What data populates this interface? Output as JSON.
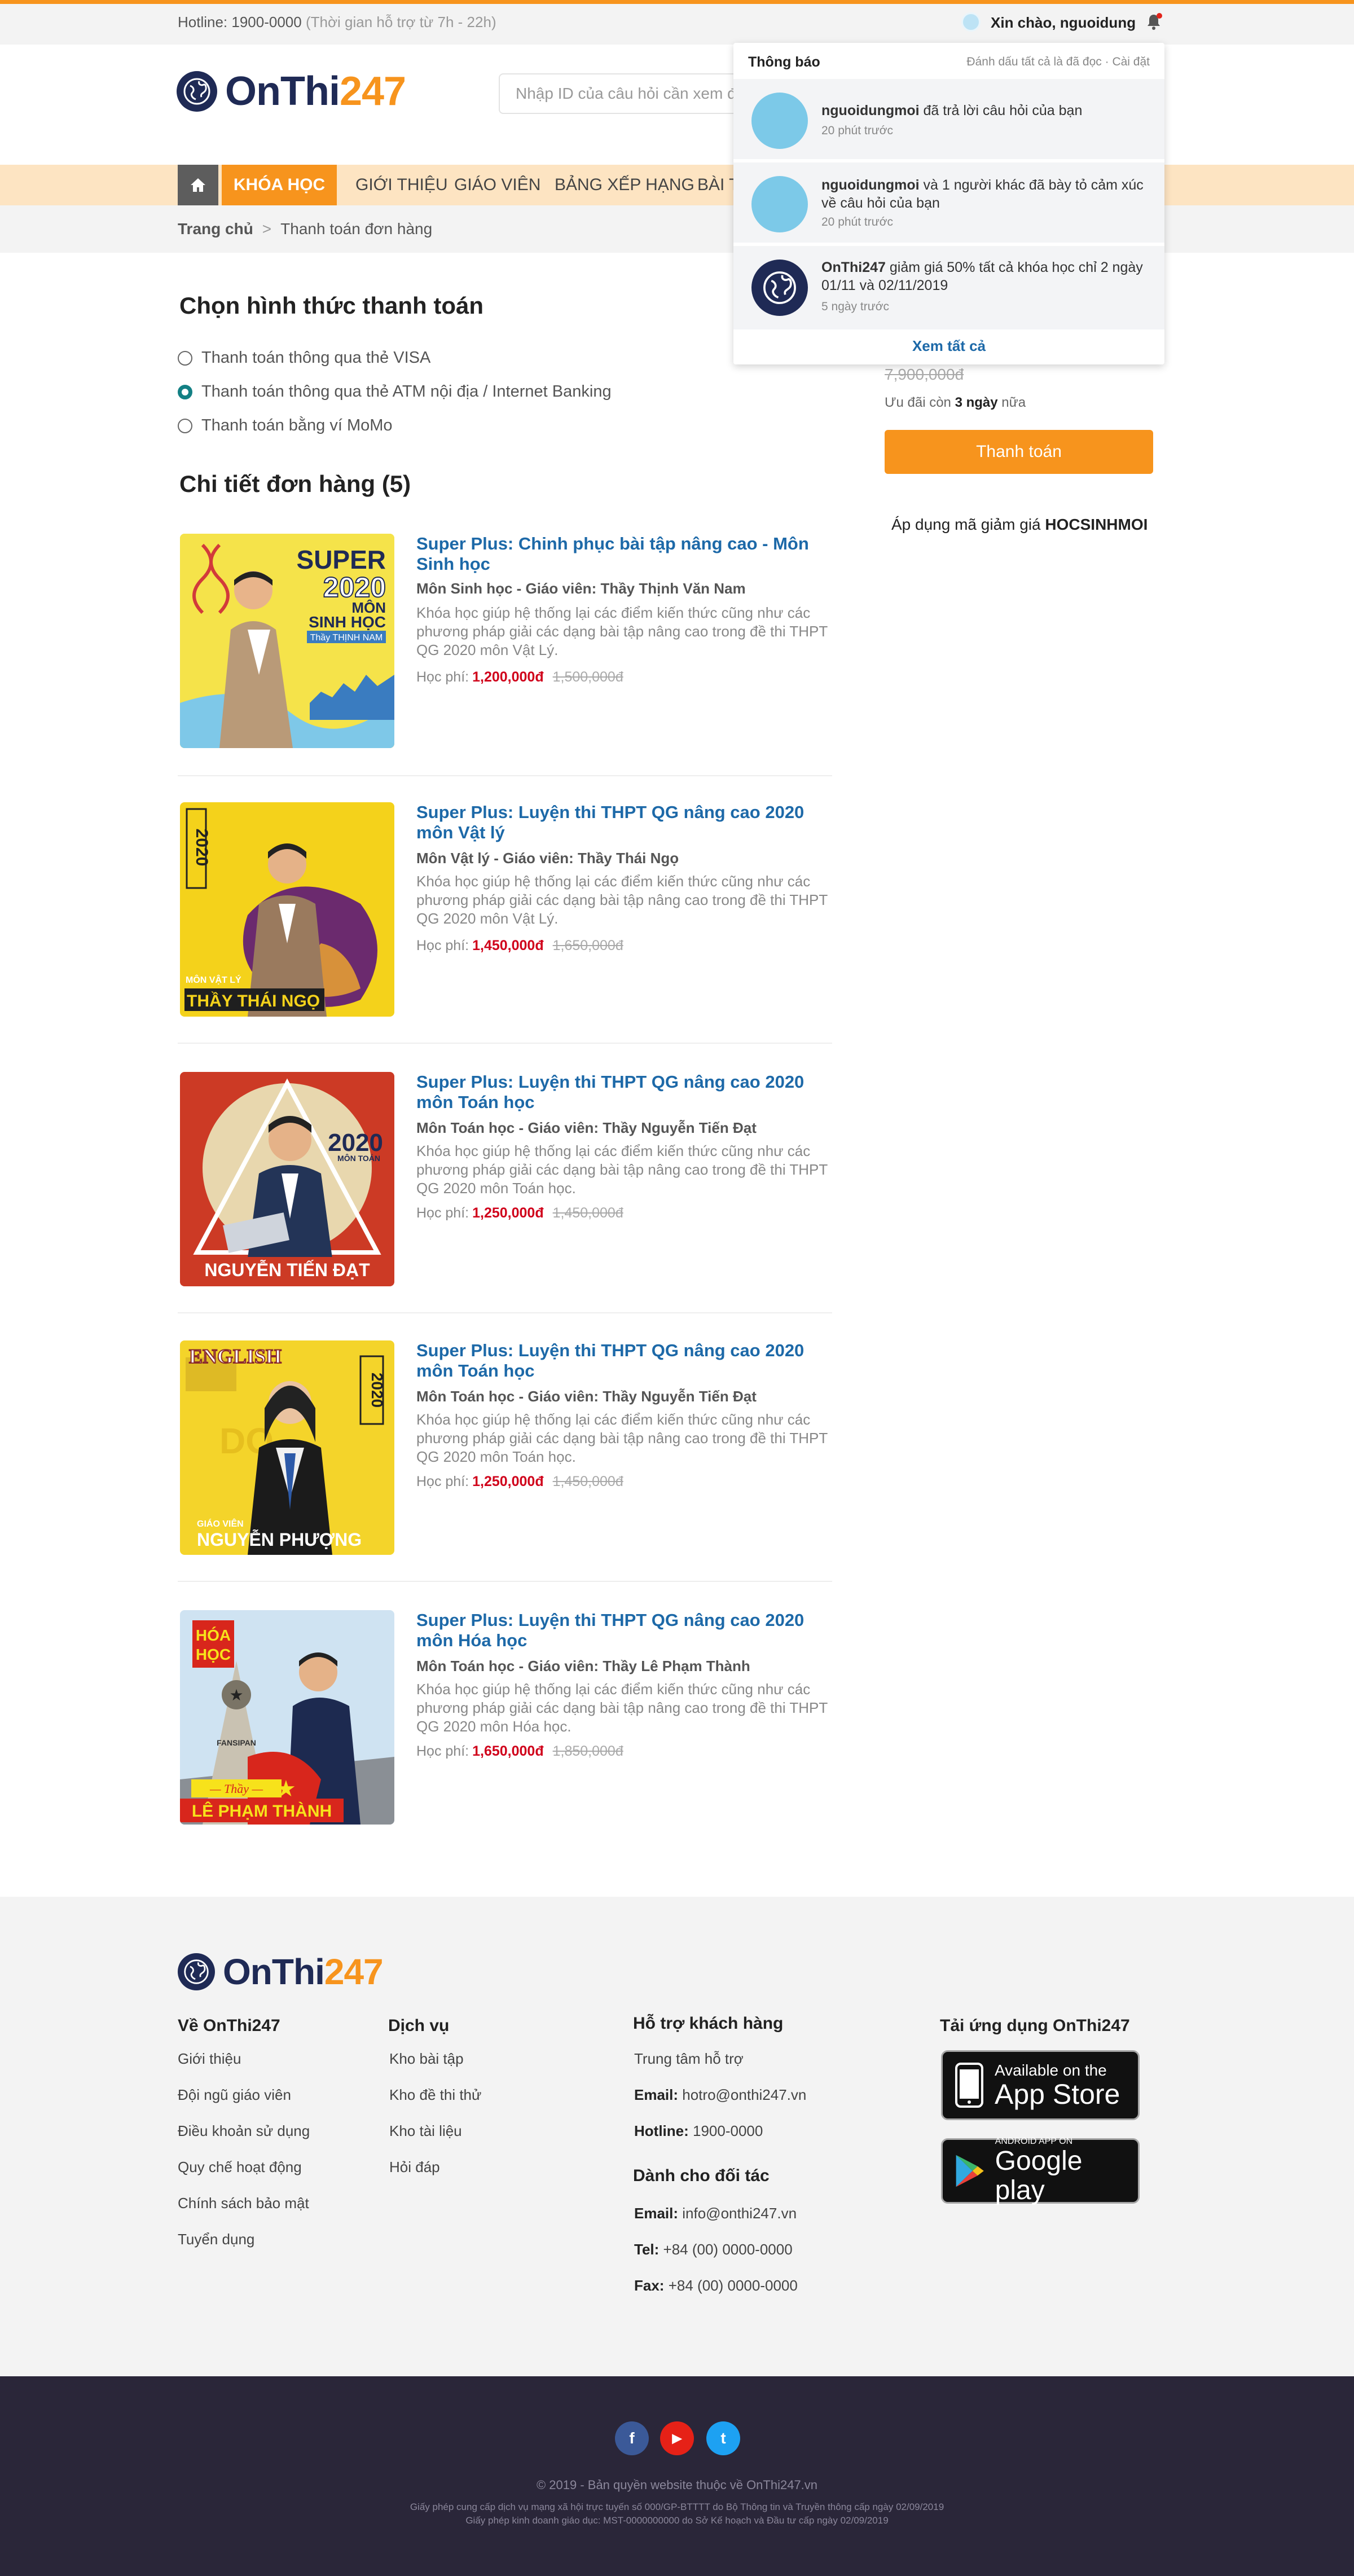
{
  "colors": {
    "accent": "#f7941d",
    "navy": "#1f2a55",
    "link": "#1d69a8",
    "price": "#d0021b",
    "teal": "#138084"
  },
  "topbar": {
    "hotline_label": "Hotline: 1900-0000",
    "hotline_hours": "(Thời gian hỗ trợ từ 7h - 22h)",
    "greeting": "Xin chào, nguoidung"
  },
  "header": {
    "logo_a": "OnThi",
    "logo_b": "247",
    "search_placeholder": "Nhập ID của câu hỏi cần xem đ"
  },
  "nav": {
    "active": "KHÓA HỌC",
    "items": [
      "GIỚI THIỆU",
      "GIÁO VIÊN",
      "BẢNG XẾP HẠNG",
      "BÀI T"
    ]
  },
  "breadcrumb": {
    "home": "Trang chủ",
    "sep": ">",
    "current": "Thanh toán đơn hàng"
  },
  "payment": {
    "title": "Chọn hình thức thanh toán",
    "options": [
      "Thanh toán thông qua thẻ VISA",
      "Thanh toán thông qua thẻ ATM nội địa / Internet Banking",
      "Thanh toán bằng ví MoMo"
    ],
    "selected": 1
  },
  "order": {
    "title": "Chi tiết đơn hàng (5)",
    "fee_label": "Học phí:",
    "courses": [
      {
        "title": "Super Plus: Chinh phục bài tập nâng cao - Môn Sinh học",
        "meta": "Môn Sinh học - Giáo viên: Thầy Thịnh Văn Nam",
        "desc": "Khóa học giúp hệ thống lại các điểm kiến thức cũng như các phương pháp giải các dạng bài tập nâng cao trong đề thi THPT QG 2020 môn Vật Lý.",
        "price": "1,200,000đ",
        "old": "1,500,000đ",
        "poster": {
          "line1": "SUPER",
          "line2": "2020",
          "line3": "MÔN",
          "line4": "SINH HỌC",
          "line5": "Thầy THỊNH NAM"
        }
      },
      {
        "title": "Super Plus: Luyện thi THPT QG nâng cao 2020 môn Vật lý",
        "meta": "Môn Vật lý - Giáo viên: Thầy Thái Ngọ",
        "desc": "Khóa học giúp hệ thống lại các điểm kiến thức cũng như các phương pháp giải các dạng bài tập nâng cao trong đề thi THPT QG 2020 môn Vật Lý.",
        "price": "1,450,000đ",
        "old": "1,650,000đ",
        "poster": {
          "line1": "2020",
          "line2": "MÔN VẬT LÝ",
          "line3": "THẦY THÁI NGỌ"
        }
      },
      {
        "title": "Super Plus: Luyện thi THPT QG nâng cao 2020 môn Toán học",
        "meta": "Môn Toán học - Giáo viên: Thầy Nguyễn Tiến Đạt",
        "desc": "Khóa học giúp hệ thống lại các điểm kiến thức cũng như các phương pháp giải các dạng bài tập nâng cao trong đề thi THPT QG 2020 môn Toán học.",
        "price": "1,250,000đ",
        "old": "1,450,000đ",
        "poster": {
          "line1": "2020",
          "line2": "MÔN TOÁN",
          "line3": "NGUYỄN TIẾN ĐẠT"
        }
      },
      {
        "title": "Super Plus: Luyện thi THPT QG nâng cao 2020 môn Toán học",
        "meta": "Môn Toán học - Giáo viên: Thầy Nguyễn Tiến Đạt",
        "desc": "Khóa học giúp hệ thống lại các điểm kiến thức cũng như các phương pháp giải các dạng bài tập nâng cao trong đề thi THPT QG 2020 môn Toán học.",
        "price": "1,250,000đ",
        "old": "1,450,000đ",
        "poster": {
          "line1": "ENGLISH",
          "line2": "2020",
          "line3": "GIÁO VIÊN",
          "line4": "NGUYỄN PHƯỢNG"
        }
      },
      {
        "title": "Super Plus: Luyện thi THPT QG nâng cao 2020 môn Hóa học",
        "meta": "Môn Toán học - Giáo viên: Thầy Lê Phạm Thành",
        "desc": "Khóa học giúp hệ thống lại các điểm kiến thức cũng như các phương pháp giải các dạng bài tập nâng cao trong đề thi THPT QG 2020 môn Hóa học.",
        "price": "1,650,000đ",
        "old": "1,850,000đ",
        "poster": {
          "line1": "HÓA",
          "line2": "HỌC",
          "line3": "FANSIPAN",
          "line4": "— Thầy —",
          "line5": "LÊ PHẠM THÀNH"
        }
      }
    ]
  },
  "summary": {
    "old_total": "7,900,000đ",
    "remain_pre": "Ưu đãi còn ",
    "remain_days": "3 ngày",
    "remain_post": " nữa",
    "pay_button": "Thanh toán",
    "promo_pre": "Áp dụng mã giảm giá ",
    "promo_code": "HOCSINHMOI"
  },
  "notifications": {
    "title": "Thông báo",
    "mark_all": "Đánh dấu tất cả là đã đọc",
    "dot": "·",
    "settings": "Cài đặt",
    "view_all": "Xem tất cả",
    "items": [
      {
        "who": "nguoidungmoi",
        "text": " đã trả lời câu hỏi của bạn",
        "time": "20 phút trước"
      },
      {
        "who": "nguoidungmoi",
        "text": " và 1 người khác đã bày tỏ cảm xúc về câu hỏi của bạn",
        "time": "20 phút trước"
      },
      {
        "who": "OnThi247",
        "text": " giảm giá 50% tất cả khóa học chỉ 2 ngày 01/11 và 02/11/2019",
        "time": "5 ngày trước"
      }
    ]
  },
  "footer": {
    "about": {
      "title": "Về OnThi247",
      "links": [
        "Giới thiệu",
        "Đội ngũ giáo viên",
        "Điều khoản sử dụng",
        "Quy chế hoạt động",
        "Chính sách bảo mật",
        "Tuyển dụng"
      ]
    },
    "services": {
      "title": "Dịch vụ",
      "links": [
        "Kho bài tập",
        "Kho đề thi thử",
        "Kho tài liệu",
        "Hỏi đáp"
      ]
    },
    "support": {
      "title": "Hỗ trợ khách hàng",
      "center": "Trung tâm hỗ trợ",
      "email_label": "Email:",
      "email": "hotro@onthi247.vn",
      "hotline_label": "Hotline:",
      "hotline": "1900-0000"
    },
    "partners": {
      "title": "Dành cho đối tác",
      "email_label": "Email:",
      "email": "info@onthi247.vn",
      "tel_label": "Tel:",
      "tel": "+84 (00) 0000-0000",
      "fax_label": "Fax:",
      "fax": "+84 (00) 0000-0000"
    },
    "apps": {
      "title": "Tải ứng dụng OnThi247",
      "appstore_small": "Available on the",
      "appstore_big": "App Store",
      "gplay_small": "ANDROID APP ON",
      "gplay_big": "Google play"
    },
    "copyright": "© 2019 - Bản quyền website thuộc về OnThi247.vn",
    "license1": "Giấy phép cung cấp dịch vụ mạng xã hội trực tuyến số 000/GP-BTTTT do Bộ Thông tin và Truyền thông cấp ngày 02/09/2019",
    "license2": "Giấy phép kinh doanh giáo dục: MST-0000000000 do Sở Kế hoạch và Đầu tư cấp ngày 02/09/2019"
  },
  "social": {
    "facebook": "f",
    "youtube": "▶",
    "twitter": "t"
  }
}
